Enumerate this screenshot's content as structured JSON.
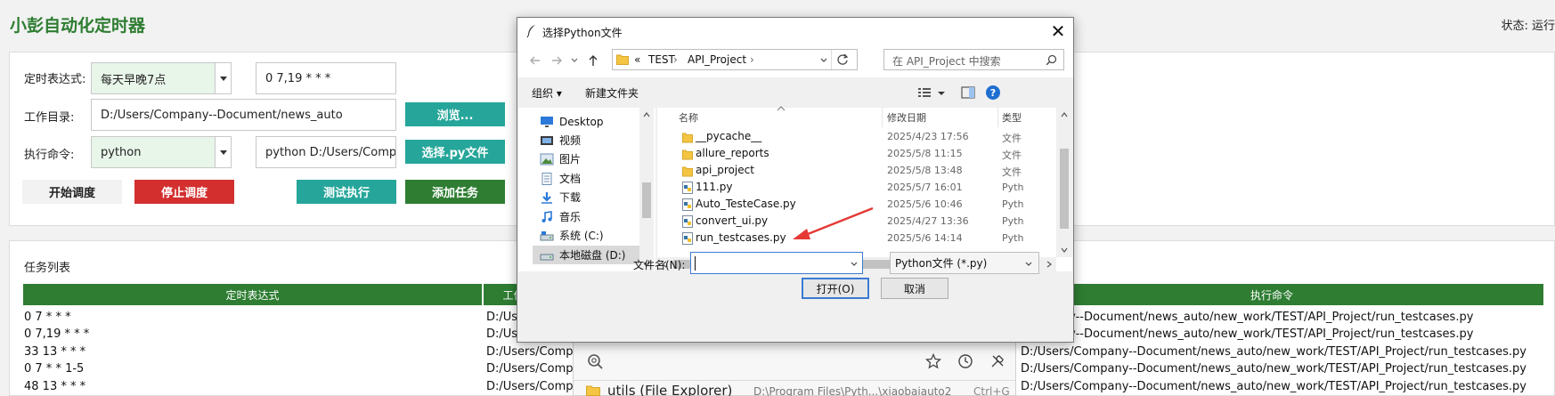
{
  "app": {
    "title": "小彭自动化定时器",
    "status": "状态: 运行"
  },
  "config": {
    "cron_label": "定时表达式:",
    "cron_preset": "每天早晚7点",
    "cron_value": "0 7,19 * * *",
    "workdir_label": "工作目录:",
    "workdir_value": "D:/Users/Company--Document/news_auto",
    "browse_button": "浏览...",
    "command_label": "执行命令:",
    "command_preset": "python",
    "command_value": "python D:/Users/Compa",
    "select_py_button": "选择.py文件",
    "start_button": "开始调度",
    "stop_button": "停止调度",
    "test_button": "测试执行",
    "add_button": "添加任务"
  },
  "tasks": {
    "title": "任务列表",
    "columns": [
      "定时表达式",
      "工作目录",
      "执行命令"
    ],
    "rows": [
      {
        "cron": "0 7 * * *",
        "dir": "D:/Users",
        "cmd": "Company--Document/news_auto/new_work/TEST/API_Project/run_testcases.py"
      },
      {
        "cron": "0 7,19 * * *",
        "dir": "D:/Users",
        "cmd": "Company--Document/news_auto/new_work/TEST/API_Project/run_testcases.py"
      },
      {
        "cron": "33 13 * * *",
        "dir": "D:/Users/Compan",
        "cmd": "D:/Users/Company--Document/news_auto/new_work/TEST/API_Project/run_testcases.py"
      },
      {
        "cron": "0 7 * * 1-5",
        "dir": "D:/Users/Compan",
        "cmd": "D:/Users/Company--Document/news_auto/new_work/TEST/API_Project/run_testcases.py"
      },
      {
        "cron": "48 13 * * *",
        "dir": "D:/Users/Compan",
        "cmd": "D:/Users/Company--Document/news_auto/new_work/TEST/API_Project/run_testcases.py"
      }
    ]
  },
  "popup": {
    "item_label": "utils (File Explorer)",
    "item_path": "D:\\Program Files\\Pyth...\\xiaobaiauto2",
    "item_shortcut": "Ctrl+G"
  },
  "dialog": {
    "title": "选择Python文件",
    "breadcrumb": [
      "«",
      "TEST",
      "API_Project"
    ],
    "search_placeholder": "在 API_Project 中搜索",
    "organize": "组织 ▾",
    "new_folder": "新建文件夹",
    "nav_items": [
      {
        "label": "Desktop",
        "icon": "desktop-icon"
      },
      {
        "label": "视频",
        "icon": "video-icon"
      },
      {
        "label": "图片",
        "icon": "picture-icon"
      },
      {
        "label": "文档",
        "icon": "document-icon"
      },
      {
        "label": "下载",
        "icon": "download-icon"
      },
      {
        "label": "音乐",
        "icon": "music-icon"
      },
      {
        "label": "系统 (C:)",
        "icon": "drive-icon"
      },
      {
        "label": "本地磁盘 (D:)",
        "icon": "drive-icon"
      }
    ],
    "columns": {
      "name": "名称",
      "date": "修改日期",
      "type": "类型"
    },
    "files": [
      {
        "name": "__pycache__",
        "date": "2025/4/23 17:56",
        "type": "文件",
        "kind": "folder"
      },
      {
        "name": "allure_reports",
        "date": "2025/5/8 11:15",
        "type": "文件",
        "kind": "folder"
      },
      {
        "name": "api_project",
        "date": "2025/5/8 13:48",
        "type": "文件",
        "kind": "folder"
      },
      {
        "name": "111.py",
        "date": "2025/5/7 16:01",
        "type": "Pyth",
        "kind": "py"
      },
      {
        "name": "Auto_TesteCase.py",
        "date": "2025/5/6 10:46",
        "type": "Pyth",
        "kind": "py"
      },
      {
        "name": "convert_ui.py",
        "date": "2025/4/27 13:36",
        "type": "Pyth",
        "kind": "py"
      },
      {
        "name": "run_testcases.py",
        "date": "2025/5/6 14:14",
        "type": "Pyth",
        "kind": "py"
      }
    ],
    "filename_label": "文件名(N):",
    "filename_value": "",
    "filter_value": "Python文件 (*.py)",
    "open_button": "打开(O)",
    "cancel_button": "取消"
  },
  "colors": {
    "brand_green": "#2e7d32",
    "teal": "#26a69a",
    "red": "#d32f2f",
    "arrow_red": "#e53935"
  }
}
